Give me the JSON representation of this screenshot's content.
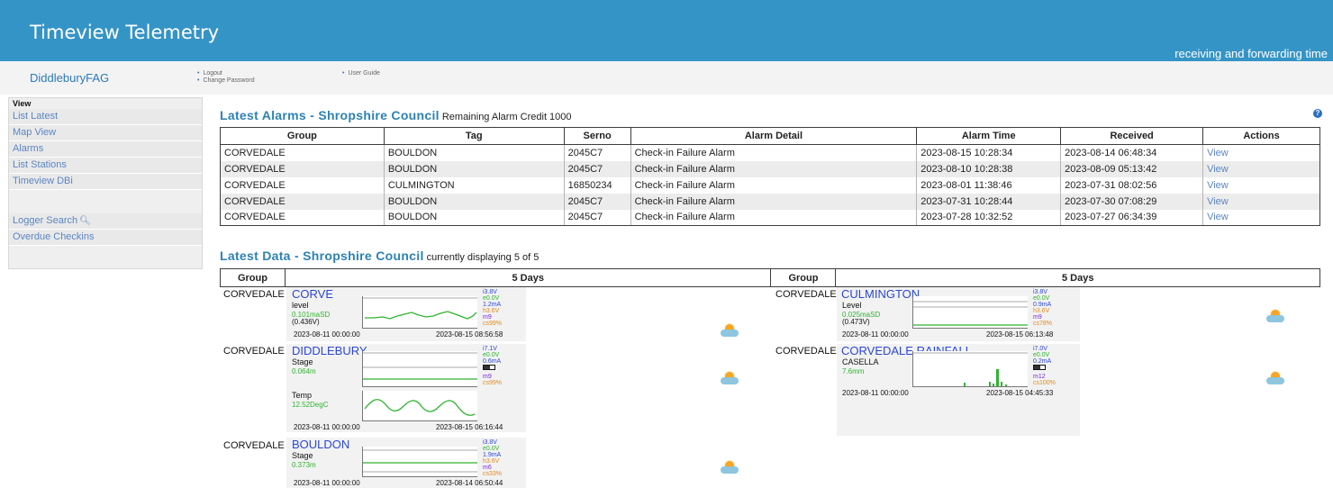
{
  "header": {
    "title": "Timeview Telemetry",
    "tagline": "receiving and forwarding time"
  },
  "subbar": {
    "account": "DiddleburyFAG",
    "links": [
      "Logout",
      "Change Password",
      "User Guide"
    ]
  },
  "sidebar": {
    "heading": "View",
    "items": [
      "List Latest",
      "Map View",
      "Alarms",
      "List Stations",
      "Timeview DBi",
      "Logger Search",
      "Overdue Checkins"
    ]
  },
  "alarms": {
    "title": "Latest Alarms - Shropshire Council",
    "subtitle": "Remaining Alarm Credit 1000",
    "columns": [
      "Group",
      "Tag",
      "Serno",
      "Alarm Detail",
      "Alarm Time",
      "Received",
      "Actions"
    ],
    "rows": [
      [
        "CORVEDALE",
        "BOULDON",
        "2045C7",
        "Check-in Failure Alarm",
        "2023-08-15 10:28:34",
        "2023-08-14 06:48:34",
        "View"
      ],
      [
        "CORVEDALE",
        "BOULDON",
        "2045C7",
        "Check-in Failure Alarm",
        "2023-08-10 10:28:38",
        "2023-08-09 05:13:42",
        "View"
      ],
      [
        "CORVEDALE",
        "CULMINGTON",
        "16850234",
        "Check-in Failure Alarm",
        "2023-08-01 11:38:46",
        "2023-07-31 08:02:56",
        "View"
      ],
      [
        "CORVEDALE",
        "BOULDON",
        "2045C7",
        "Check-in Failure Alarm",
        "2023-07-31 10:28:44",
        "2023-07-30 07:08:29",
        "View"
      ],
      [
        "CORVEDALE",
        "BOULDON",
        "2045C7",
        "Check-in Failure Alarm",
        "2023-07-28 10:32:52",
        "2023-07-27 06:34:39",
        "View"
      ]
    ]
  },
  "latest": {
    "title": "Latest Data - Shropshire Council",
    "subtitle": "currently displaying 5 of 5",
    "columns": [
      "Group",
      "5 Days",
      "Group",
      "5 Days"
    ],
    "stations": [
      {
        "group": "CORVEDALE",
        "name": "CORVE",
        "series": [
          {
            "label": "level",
            "value": "0.101maSD",
            "volts": "(0.436V)"
          }
        ],
        "start": "2023-08-11 00:00:00",
        "end": "2023-08-15 08:56:58",
        "stats": {
          "i": "i3.8V",
          "e": "e0.0V",
          "ma": "1.2mA",
          "h": "h3.6V",
          "m": "m9",
          "cs": "cs99%"
        }
      },
      {
        "group": "CORVEDALE",
        "name": "DIDDLEBURY",
        "series": [
          {
            "label": "Stage",
            "value": "0.064m"
          },
          {
            "label": "Temp",
            "value": "12.52DegC"
          }
        ],
        "start": "2023-08-11 00:00:00",
        "end": "2023-08-15 06:16:44",
        "stats": {
          "i": "i7.1V",
          "e": "e0.0V",
          "ma": "0.6mA",
          "m": "m9",
          "cs": "cs99%"
        }
      },
      {
        "group": "CORVEDALE",
        "name": "BOULDON",
        "series": [
          {
            "label": "Stage",
            "value": "0.373m"
          }
        ],
        "start": "2023-08-11 00:00:00",
        "end": "2023-08-14 06:50:44",
        "stats": {
          "i": "i3.8V",
          "e": "e0.0V",
          "ma": "1.9mA",
          "h": "h3.6V",
          "m": "m6",
          "cs": "cs33%"
        }
      },
      {
        "group": "CORVEDALE",
        "name": "CULMINGTON",
        "series": [
          {
            "label": "Level",
            "value": "0.025maSD",
            "volts": "(0.473V)"
          }
        ],
        "start": "2023-08-11 00:00:00",
        "end": "2023-08-15 06:13:48",
        "stats": {
          "i": "i3.8V",
          "e": "e0.0V",
          "ma": "0.9mA",
          "h": "h3.6V",
          "m": "m9",
          "cs": "cs78%"
        }
      },
      {
        "group": "CORVEDALE",
        "name": "CORVEDALE RAINFALL",
        "series": [
          {
            "label": "CASELLA",
            "value": "7.6mm"
          }
        ],
        "start": "2023-08-11 00:00:00",
        "end": "2023-08-15 04:45:33",
        "stats": {
          "i": "i7.0V",
          "e": "e0.0V",
          "ma": "0.2mA",
          "m": "m12",
          "cs": "cs100%"
        }
      }
    ]
  }
}
